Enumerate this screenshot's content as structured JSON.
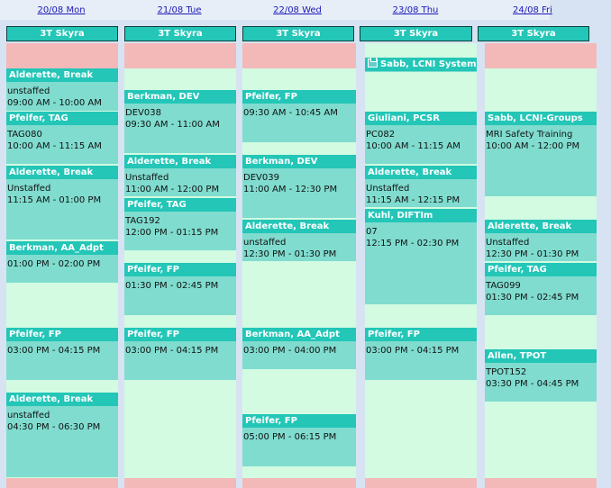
{
  "days": [
    {
      "header": "20/08 Mon",
      "resource": "3T Skyra"
    },
    {
      "header": "21/08 Tue",
      "resource": "3T Skyra"
    },
    {
      "header": "22/08 Wed",
      "resource": "3T Skyra"
    },
    {
      "header": "23/08 Thu",
      "resource": "3T Skyra"
    },
    {
      "header": "24/08 Fri",
      "resource": "3T Skyra"
    }
  ],
  "appointments": {
    "mon": [
      {
        "title": "Alderette, Break",
        "detail": "unstaffed",
        "time": "09:00 AM - 10:00 AM"
      },
      {
        "title": "Pfeifer, TAG",
        "detail": "TAG080",
        "time": "10:00 AM - 11:15 AM"
      },
      {
        "title": "Alderette, Break",
        "detail": "Unstaffed",
        "time": "11:15 AM - 01:00 PM"
      },
      {
        "title": "Berkman, AA_Adpt",
        "detail": "",
        "time": "01:00 PM - 02:00 PM"
      },
      {
        "title": "Pfeifer, FP",
        "detail": "",
        "time": "03:00 PM - 04:15 PM"
      },
      {
        "title": "Alderette, Break",
        "detail": "unstaffed",
        "time": "04:30 PM - 06:30 PM"
      }
    ],
    "tue": [
      {
        "title": "Berkman, DEV",
        "detail": "DEV038",
        "time": "09:30 AM - 11:00 AM"
      },
      {
        "title": "Alderette, Break",
        "detail": "Unstaffed",
        "time": "11:00 AM - 12:00 PM"
      },
      {
        "title": "Pfeifer, TAG",
        "detail": "TAG192",
        "time": "12:00 PM - 01:15 PM"
      },
      {
        "title": "Pfeifer, FP",
        "detail": "",
        "time": "01:30 PM - 02:45 PM"
      },
      {
        "title": "Pfeifer, FP",
        "detail": "",
        "time": "03:00 PM - 04:15 PM"
      }
    ],
    "wed": [
      {
        "title": "Pfeifer, FP",
        "detail": "",
        "time": "09:30 AM - 10:45 AM"
      },
      {
        "title": "Berkman, DEV",
        "detail": "DEV039",
        "time": "11:00 AM - 12:30 PM"
      },
      {
        "title": "Alderette, Break",
        "detail": "unstaffed",
        "time": "12:30 PM - 01:30 PM"
      },
      {
        "title": "Berkman, AA_Adpt",
        "detail": "",
        "time": "03:00 PM - 04:00 PM"
      },
      {
        "title": "Pfeifer, FP",
        "detail": "",
        "time": "05:00 PM - 06:15 PM"
      }
    ],
    "thu": [
      {
        "title": "Sabb, LCNI System Test",
        "detail": "",
        "time": ""
      },
      {
        "title": "Giuliani, PCSR",
        "detail": "PC082",
        "time": "10:00 AM - 11:15 AM"
      },
      {
        "title": "Alderette, Break",
        "detail": "Unstaffed",
        "time": "11:15 AM - 12:15 PM"
      },
      {
        "title": "Kuhl, DIFTIm",
        "detail": "07",
        "time": "12:15 PM - 02:30 PM"
      },
      {
        "title": "Pfeifer, FP",
        "detail": "",
        "time": "03:00 PM - 04:15 PM"
      }
    ],
    "fri": [
      {
        "title": "Sabb, LCNI-Groups",
        "detail": "MRI Safety Training",
        "time": "10:00 AM - 12:00 PM"
      },
      {
        "title": "Alderette, Break",
        "detail": "Unstaffed",
        "time": "12:30 PM - 01:30 PM"
      },
      {
        "title": "Pfeifer, TAG",
        "detail": "TAG099",
        "time": "01:30 PM - 02:45 PM"
      },
      {
        "title": "Allen, TPOT",
        "detail": "TPOT152",
        "time": "03:30 PM - 04:45 PM"
      }
    ]
  },
  "colors": {
    "header_link": "#1a1ab8",
    "resource_header": "#23c6b7",
    "available_slot": "#d2fbe2",
    "booked_slot": "#7fdccf",
    "blocked_slot": "#f3b9b9",
    "background": "#d7e3f2"
  },
  "icons": {
    "calendar_item": "calendar-copy-icon"
  }
}
